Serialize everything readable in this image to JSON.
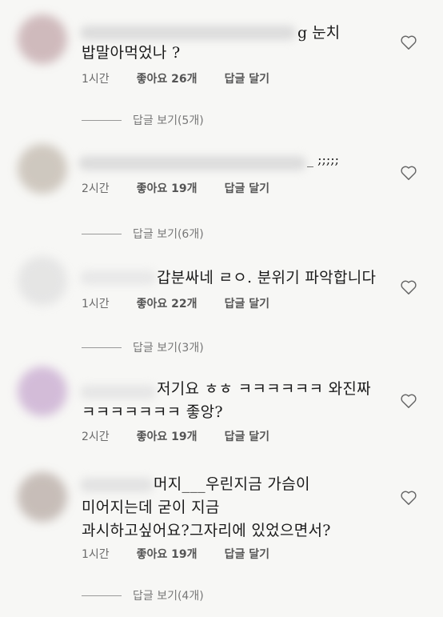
{
  "comments": [
    {
      "text_visible": "g 눈치",
      "text": "밥말아먹었나 ?",
      "time": "1시간",
      "likes": "좋아요 26개",
      "reply": "답글 달기",
      "view_replies": "답글 보기(5개)",
      "avatar_color": "#c9b0b3"
    },
    {
      "text_visible": "_ ;;;;;",
      "text": "",
      "time": "2시간",
      "likes": "좋아요 19개",
      "reply": "답글 달기",
      "view_replies": "답글 보기(6개)",
      "avatar_color": "#c8c0b6"
    },
    {
      "text_visible": "",
      "text": "갑분싸네 ㄹㅇ. 분위기 파악합니다",
      "time": "1시간",
      "likes": "좋아요 22개",
      "reply": "답글 달기",
      "view_replies": "답글 보기(3개)",
      "avatar_color": "#e2e2e2"
    },
    {
      "text_visible": "",
      "text": "저기요 ㅎㅎ ㅋㅋㅋㅋㅋㅋ 와진짜\nㅋㅋㅋㅋㅋㅋㅋ 좋앙?",
      "time": "2시간",
      "likes": "좋아요 19개",
      "reply": "답글 달기",
      "view_replies": "",
      "avatar_color": "#cdb2d4"
    },
    {
      "text_visible": "",
      "text": "머지___우린지금 가슴이\n미어지는데 굳이 지금\n과시하고싶어요?그자리에 있었으면서?",
      "time": "1시간",
      "likes": "좋아요 19개",
      "reply": "답글 달기",
      "view_replies": "답글 보기(4개)",
      "avatar_color": "#bfb4ae"
    }
  ],
  "icons": {
    "like": "heart-outline-icon"
  }
}
